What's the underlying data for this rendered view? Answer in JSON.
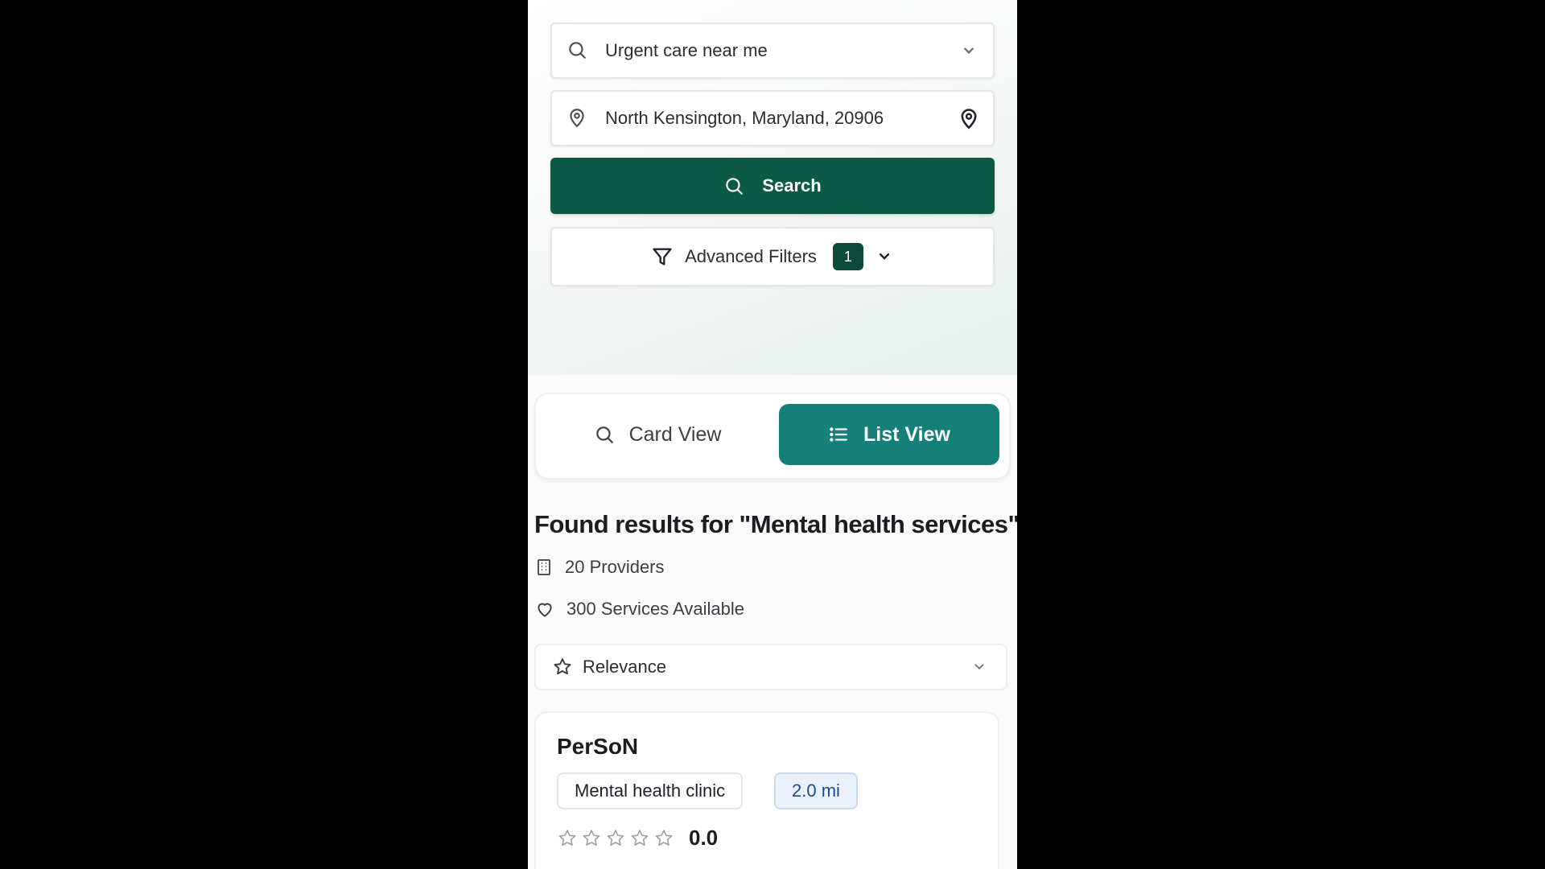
{
  "search": {
    "query": "Urgent care near me",
    "location": "North Kensington, Maryland, 20906",
    "button_label": "Search",
    "filters_label": "Advanced Filters",
    "filters_count": "1"
  },
  "view_toggle": {
    "card_label": "Card View",
    "list_label": "List View",
    "active": "list"
  },
  "results": {
    "title": "Found results for \"Mental health services\"",
    "providers": "20 Providers",
    "services": "300 Services Available",
    "sort_label": "Relevance"
  },
  "cards": [
    {
      "name": "PerSoN",
      "type": "Mental health clinic",
      "distance": "2.0 mi",
      "rating": "0.0",
      "stars_filled": 0,
      "stars_total": 5
    }
  ],
  "colors": {
    "primary": "#0b5a46",
    "toggle_active": "#157f79",
    "badge": "#0b4a3a",
    "distance_chip_bg": "#eaf1fb"
  },
  "icons": [
    "search-icon",
    "chevron-down-icon",
    "location-pin-icon",
    "filter-icon",
    "list-icon",
    "building-icon",
    "heart-icon",
    "star-icon"
  ]
}
